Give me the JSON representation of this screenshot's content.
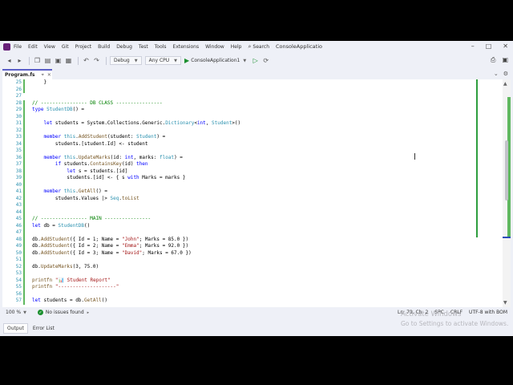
{
  "menu": {
    "items": [
      "File",
      "Edit",
      "View",
      "Git",
      "Project",
      "Build",
      "Debug",
      "Test",
      "Tools",
      "Extensions",
      "Window",
      "Help"
    ],
    "search_label": "Search",
    "solution_title": "ConsoleApplicatio"
  },
  "toolbar": {
    "config": "Debug",
    "platform": "Any CPU",
    "run_target": "ConsoleApplication1"
  },
  "tabs": {
    "active": "Program.fs"
  },
  "editor": {
    "lines": [
      {
        "n": "25",
        "parts": [
          [
            "",
            "    }"
          ]
        ]
      },
      {
        "n": "26",
        "parts": []
      },
      {
        "n": "27",
        "parts": []
      },
      {
        "n": "28",
        "parts": [
          [
            "cm",
            "// ---------------- DB CLASS ----------------"
          ]
        ]
      },
      {
        "n": "29",
        "parts": [
          [
            "kw",
            "type "
          ],
          [
            "ty",
            "StudentDB"
          ],
          [
            "",
            "() ="
          ]
        ]
      },
      {
        "n": "30",
        "parts": []
      },
      {
        "n": "31",
        "parts": [
          [
            "",
            "    "
          ],
          [
            "kw",
            "let "
          ],
          [
            "",
            "students = System.Collections.Generic."
          ],
          [
            "ty",
            "Dictionary"
          ],
          [
            "",
            "<"
          ],
          [
            "kw",
            "int"
          ],
          [
            "",
            ", "
          ],
          [
            "ty",
            "Student"
          ],
          [
            "",
            ">()"
          ]
        ]
      },
      {
        "n": "32",
        "parts": []
      },
      {
        "n": "33",
        "parts": [
          [
            "",
            "    "
          ],
          [
            "kw",
            "member "
          ],
          [
            "ty",
            "this"
          ],
          [
            "",
            "."
          ],
          [
            "fn",
            "AddStudent"
          ],
          [
            "",
            "(student: "
          ],
          [
            "ty",
            "Student"
          ],
          [
            "",
            ") ="
          ]
        ]
      },
      {
        "n": "34",
        "parts": [
          [
            "",
            "        students.[student.Id] <- student"
          ]
        ]
      },
      {
        "n": "35",
        "parts": []
      },
      {
        "n": "36",
        "parts": [
          [
            "",
            "    "
          ],
          [
            "kw",
            "member "
          ],
          [
            "ty",
            "this"
          ],
          [
            "",
            "."
          ],
          [
            "fn",
            "UpdateMarks"
          ],
          [
            "",
            "(id: "
          ],
          [
            "kw",
            "int"
          ],
          [
            "",
            ", marks: "
          ],
          [
            "ty",
            "float"
          ],
          [
            "",
            ") ="
          ]
        ]
      },
      {
        "n": "37",
        "parts": [
          [
            "",
            "        "
          ],
          [
            "kw",
            "if "
          ],
          [
            "",
            "students."
          ],
          [
            "fn",
            "ContainsKey"
          ],
          [
            "",
            "(id) "
          ],
          [
            "kw",
            "then"
          ]
        ]
      },
      {
        "n": "38",
        "parts": [
          [
            "",
            "            "
          ],
          [
            "kw",
            "let "
          ],
          [
            "",
            "s = students.[id]"
          ]
        ]
      },
      {
        "n": "39",
        "parts": [
          [
            "",
            "            students.[id] <- { s "
          ],
          [
            "kw",
            "with "
          ],
          [
            "",
            "Marks = marks }"
          ]
        ]
      },
      {
        "n": "40",
        "parts": []
      },
      {
        "n": "41",
        "parts": [
          [
            "",
            "    "
          ],
          [
            "kw",
            "member "
          ],
          [
            "ty",
            "this"
          ],
          [
            "",
            "."
          ],
          [
            "fn",
            "GetAll"
          ],
          [
            "",
            "() ="
          ]
        ]
      },
      {
        "n": "42",
        "parts": [
          [
            "",
            "        students.Values |> "
          ],
          [
            "ty",
            "Seq"
          ],
          [
            "",
            "."
          ],
          [
            "fn",
            "toList"
          ]
        ]
      },
      {
        "n": "43",
        "parts": []
      },
      {
        "n": "44",
        "parts": []
      },
      {
        "n": "45",
        "parts": [
          [
            "cm",
            "// ---------------- MAIN ----------------"
          ]
        ]
      },
      {
        "n": "46",
        "parts": [
          [
            "kw",
            "let "
          ],
          [
            "",
            "db = "
          ],
          [
            "ty",
            "StudentDB"
          ],
          [
            "",
            "()"
          ]
        ]
      },
      {
        "n": "47",
        "parts": []
      },
      {
        "n": "48",
        "parts": [
          [
            "",
            "db."
          ],
          [
            "fn",
            "AddStudent"
          ],
          [
            "",
            "({ Id = 1; Name = "
          ],
          [
            "st",
            "\"John\""
          ],
          [
            "",
            "; Marks = 85.0 })"
          ]
        ]
      },
      {
        "n": "49",
        "parts": [
          [
            "",
            "db."
          ],
          [
            "fn",
            "AddStudent"
          ],
          [
            "",
            "({ Id = 2; Name = "
          ],
          [
            "st",
            "\"Emma\""
          ],
          [
            "",
            "; Marks = 92.0 })"
          ]
        ]
      },
      {
        "n": "50",
        "parts": [
          [
            "",
            "db."
          ],
          [
            "fn",
            "AddStudent"
          ],
          [
            "",
            "({ Id = 3; Name = "
          ],
          [
            "st",
            "\"David\""
          ],
          [
            "",
            "; Marks = 67.0 })"
          ]
        ]
      },
      {
        "n": "51",
        "parts": []
      },
      {
        "n": "52",
        "parts": [
          [
            "",
            "db."
          ],
          [
            "fn",
            "UpdateMarks"
          ],
          [
            "",
            "(3, 75.0)"
          ]
        ]
      },
      {
        "n": "53",
        "parts": []
      },
      {
        "n": "54",
        "parts": [
          [
            "fn",
            "printfn "
          ],
          [
            "st",
            "\"📊 Student Report\""
          ]
        ]
      },
      {
        "n": "55",
        "parts": [
          [
            "fn",
            "printfn "
          ],
          [
            "st",
            "\"--------------------\""
          ]
        ]
      },
      {
        "n": "56",
        "parts": []
      },
      {
        "n": "57",
        "parts": [
          [
            "kw",
            "let "
          ],
          [
            "",
            "students = db."
          ],
          [
            "fn",
            "GetAll"
          ],
          [
            "",
            "()"
          ]
        ]
      }
    ]
  },
  "status": {
    "zoom": "100 %",
    "issues": "No issues found",
    "position": "Ln: 79, Ch: 2",
    "whitespace": "SPC",
    "line_ending": "CRLF",
    "encoding": "UTF-8 with BOM"
  },
  "watermark": {
    "line1": "Activate Windows",
    "line2": "Go to Settings to activate Windows."
  },
  "bottom_tabs": [
    "Output",
    "Error List"
  ]
}
